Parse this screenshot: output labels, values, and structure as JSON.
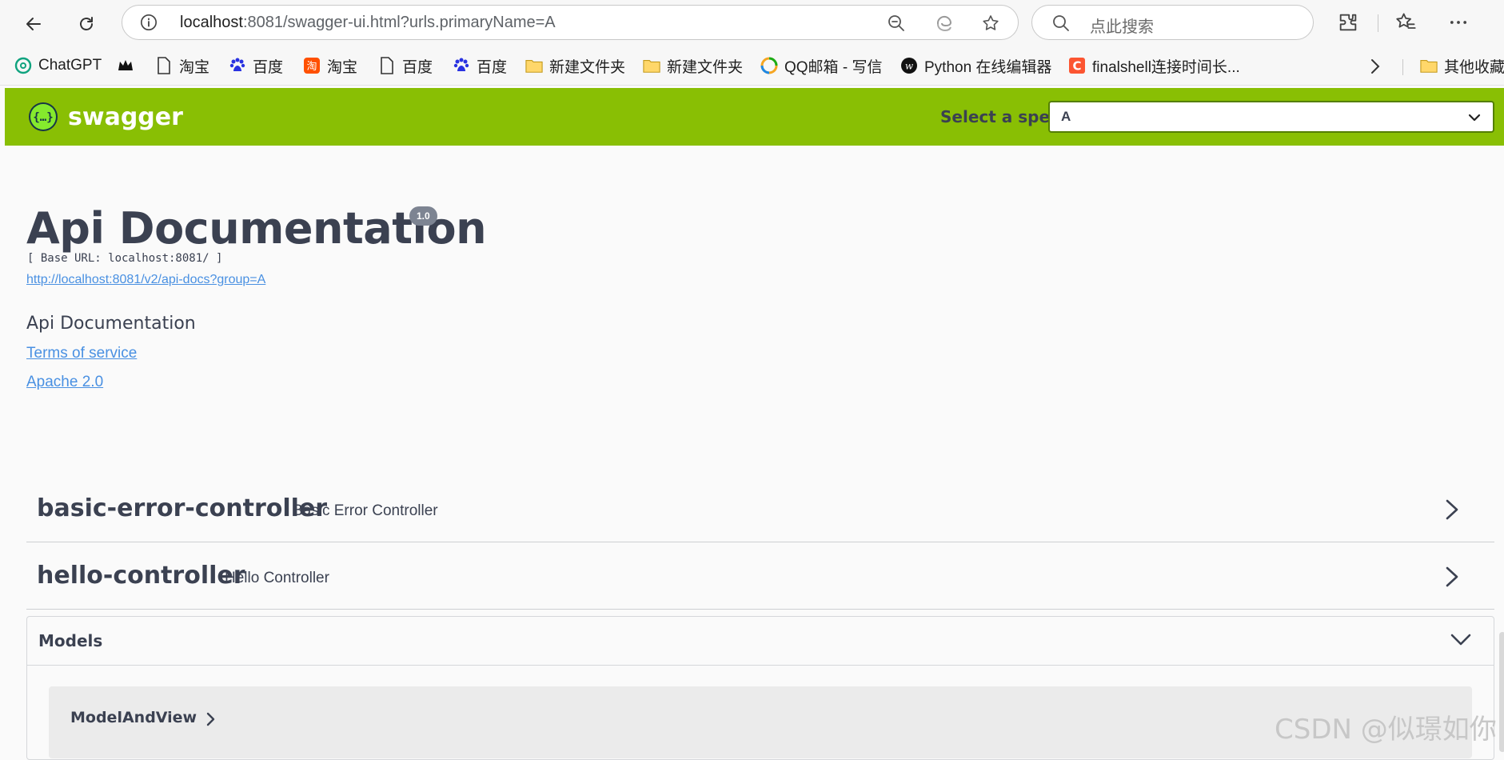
{
  "browser": {
    "url_host": "localhost",
    "url_rest": ":8081/swagger-ui.html?urls.primaryName=A",
    "search_placeholder": "点此搜索"
  },
  "bookmarks": [
    {
      "label": "ChatGPT",
      "icon": "chatgpt-icon"
    },
    {
      "label": "",
      "icon": "crown-icon"
    },
    {
      "label": "淘宝",
      "icon": "page-icon"
    },
    {
      "label": "百度",
      "icon": "baidu-paw-icon"
    },
    {
      "label": "淘宝",
      "icon": "taobao-icon"
    },
    {
      "label": "百度",
      "icon": "page-icon"
    },
    {
      "label": "百度",
      "icon": "baidu-paw-icon"
    },
    {
      "label": "新建文件夹",
      "icon": "folder-icon"
    },
    {
      "label": "新建文件夹",
      "icon": "folder-icon"
    },
    {
      "label": "QQ邮箱 - 写信",
      "icon": "qqmail-icon"
    },
    {
      "label": "Python 在线编辑器",
      "icon": "w-logo-icon"
    },
    {
      "label": "finalshell连接时间长...",
      "icon": "c-logo-icon"
    },
    {
      "label": "其他收藏",
      "icon": "folder-icon"
    }
  ],
  "swagger": {
    "brand": "swagger",
    "spec_label": "Select a spec",
    "spec_value": "A",
    "title": "Api Documentation",
    "version": "1.0",
    "base_url": "[ Base URL: localhost:8081/ ]",
    "docs_url": "http://localhost:8081/v2/api-docs?group=A",
    "description": "Api Documentation",
    "terms": "Terms of service",
    "license": "Apache 2.0",
    "tags": [
      {
        "name": "basic-error-controller",
        "desc": "Basic Error Controller"
      },
      {
        "name": "hello-controller",
        "desc": "Hello Controller"
      }
    ],
    "models_title": "Models",
    "models": [
      "ModelAndView"
    ]
  },
  "watermark": "CSDN @似璟如你",
  "colors": {
    "topbar": "#89bf04",
    "link": "#4990e2",
    "text": "#3b4151"
  }
}
